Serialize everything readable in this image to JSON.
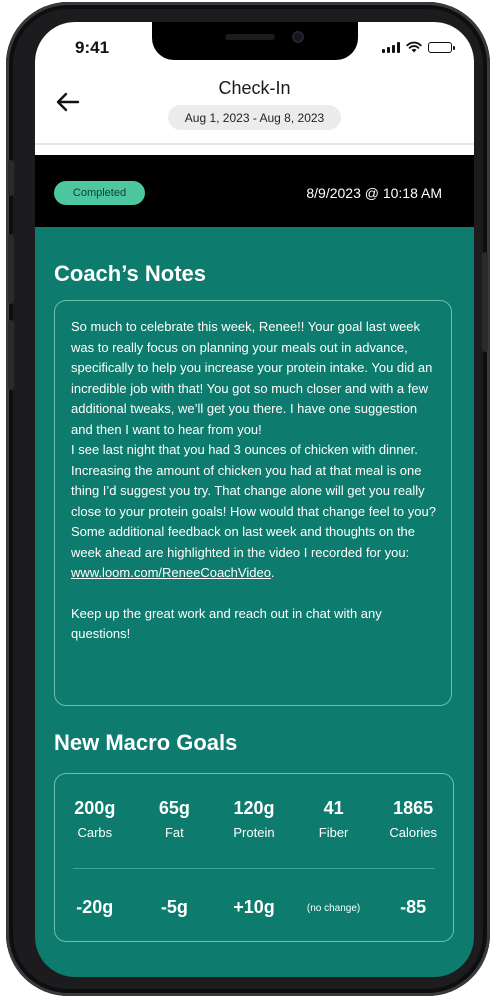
{
  "status_bar": {
    "time": "9:41"
  },
  "header": {
    "title": "Check-In",
    "date_range": "Aug 1, 2023 - Aug 8, 2023"
  },
  "checkin": {
    "status": "Completed",
    "timestamp": "8/9/2023 @ 10:18 AM"
  },
  "coach_notes": {
    "title": "Coach’s Notes",
    "paragraph_1": "So much to celebrate this week, Renee!! Your goal last week was to really focus on planning your meals out in advance, specifically to help you increase your protein intake. You did an incredible job with that! You got so much closer and with a few additional tweaks, we’ll get you there. I have one suggestion and then I want to hear from you!",
    "paragraph_2": "I see last night that you had 3 ounces of chicken with dinner. Increasing the amount of chicken you had at that meal is one thing I’d suggest you try. That change alone will get you really close to your protein goals! How would that change feel to you?",
    "paragraph_3_text": "Some additional feedback on last week and thoughts on the week ahead are highlighted in the video I recorded for you: ",
    "video_link": "www.loom.com/ReneeCoachVideo",
    "paragraph_3_end": ".",
    "closing": "Keep up the great work and reach out in chat with any questions!"
  },
  "macro_goals": {
    "title": "New Macro Goals",
    "items": [
      {
        "value": "200g",
        "label": "Carbs",
        "change": "-20g"
      },
      {
        "value": "65g",
        "label": "Fat",
        "change": "-5g"
      },
      {
        "value": "120g",
        "label": "Protein",
        "change": "+10g"
      },
      {
        "value": "41",
        "label": "Fiber",
        "change": "(no change)"
      },
      {
        "value": "1865",
        "label": "Calories",
        "change": "-85"
      }
    ]
  },
  "colors": {
    "teal_background": "#0d7b6d",
    "badge_green": "#4cc7a0",
    "box_border": "#6ebfae"
  },
  "icons": [
    "back-arrow-icon",
    "signal-icon",
    "wifi-icon",
    "battery-icon"
  ]
}
